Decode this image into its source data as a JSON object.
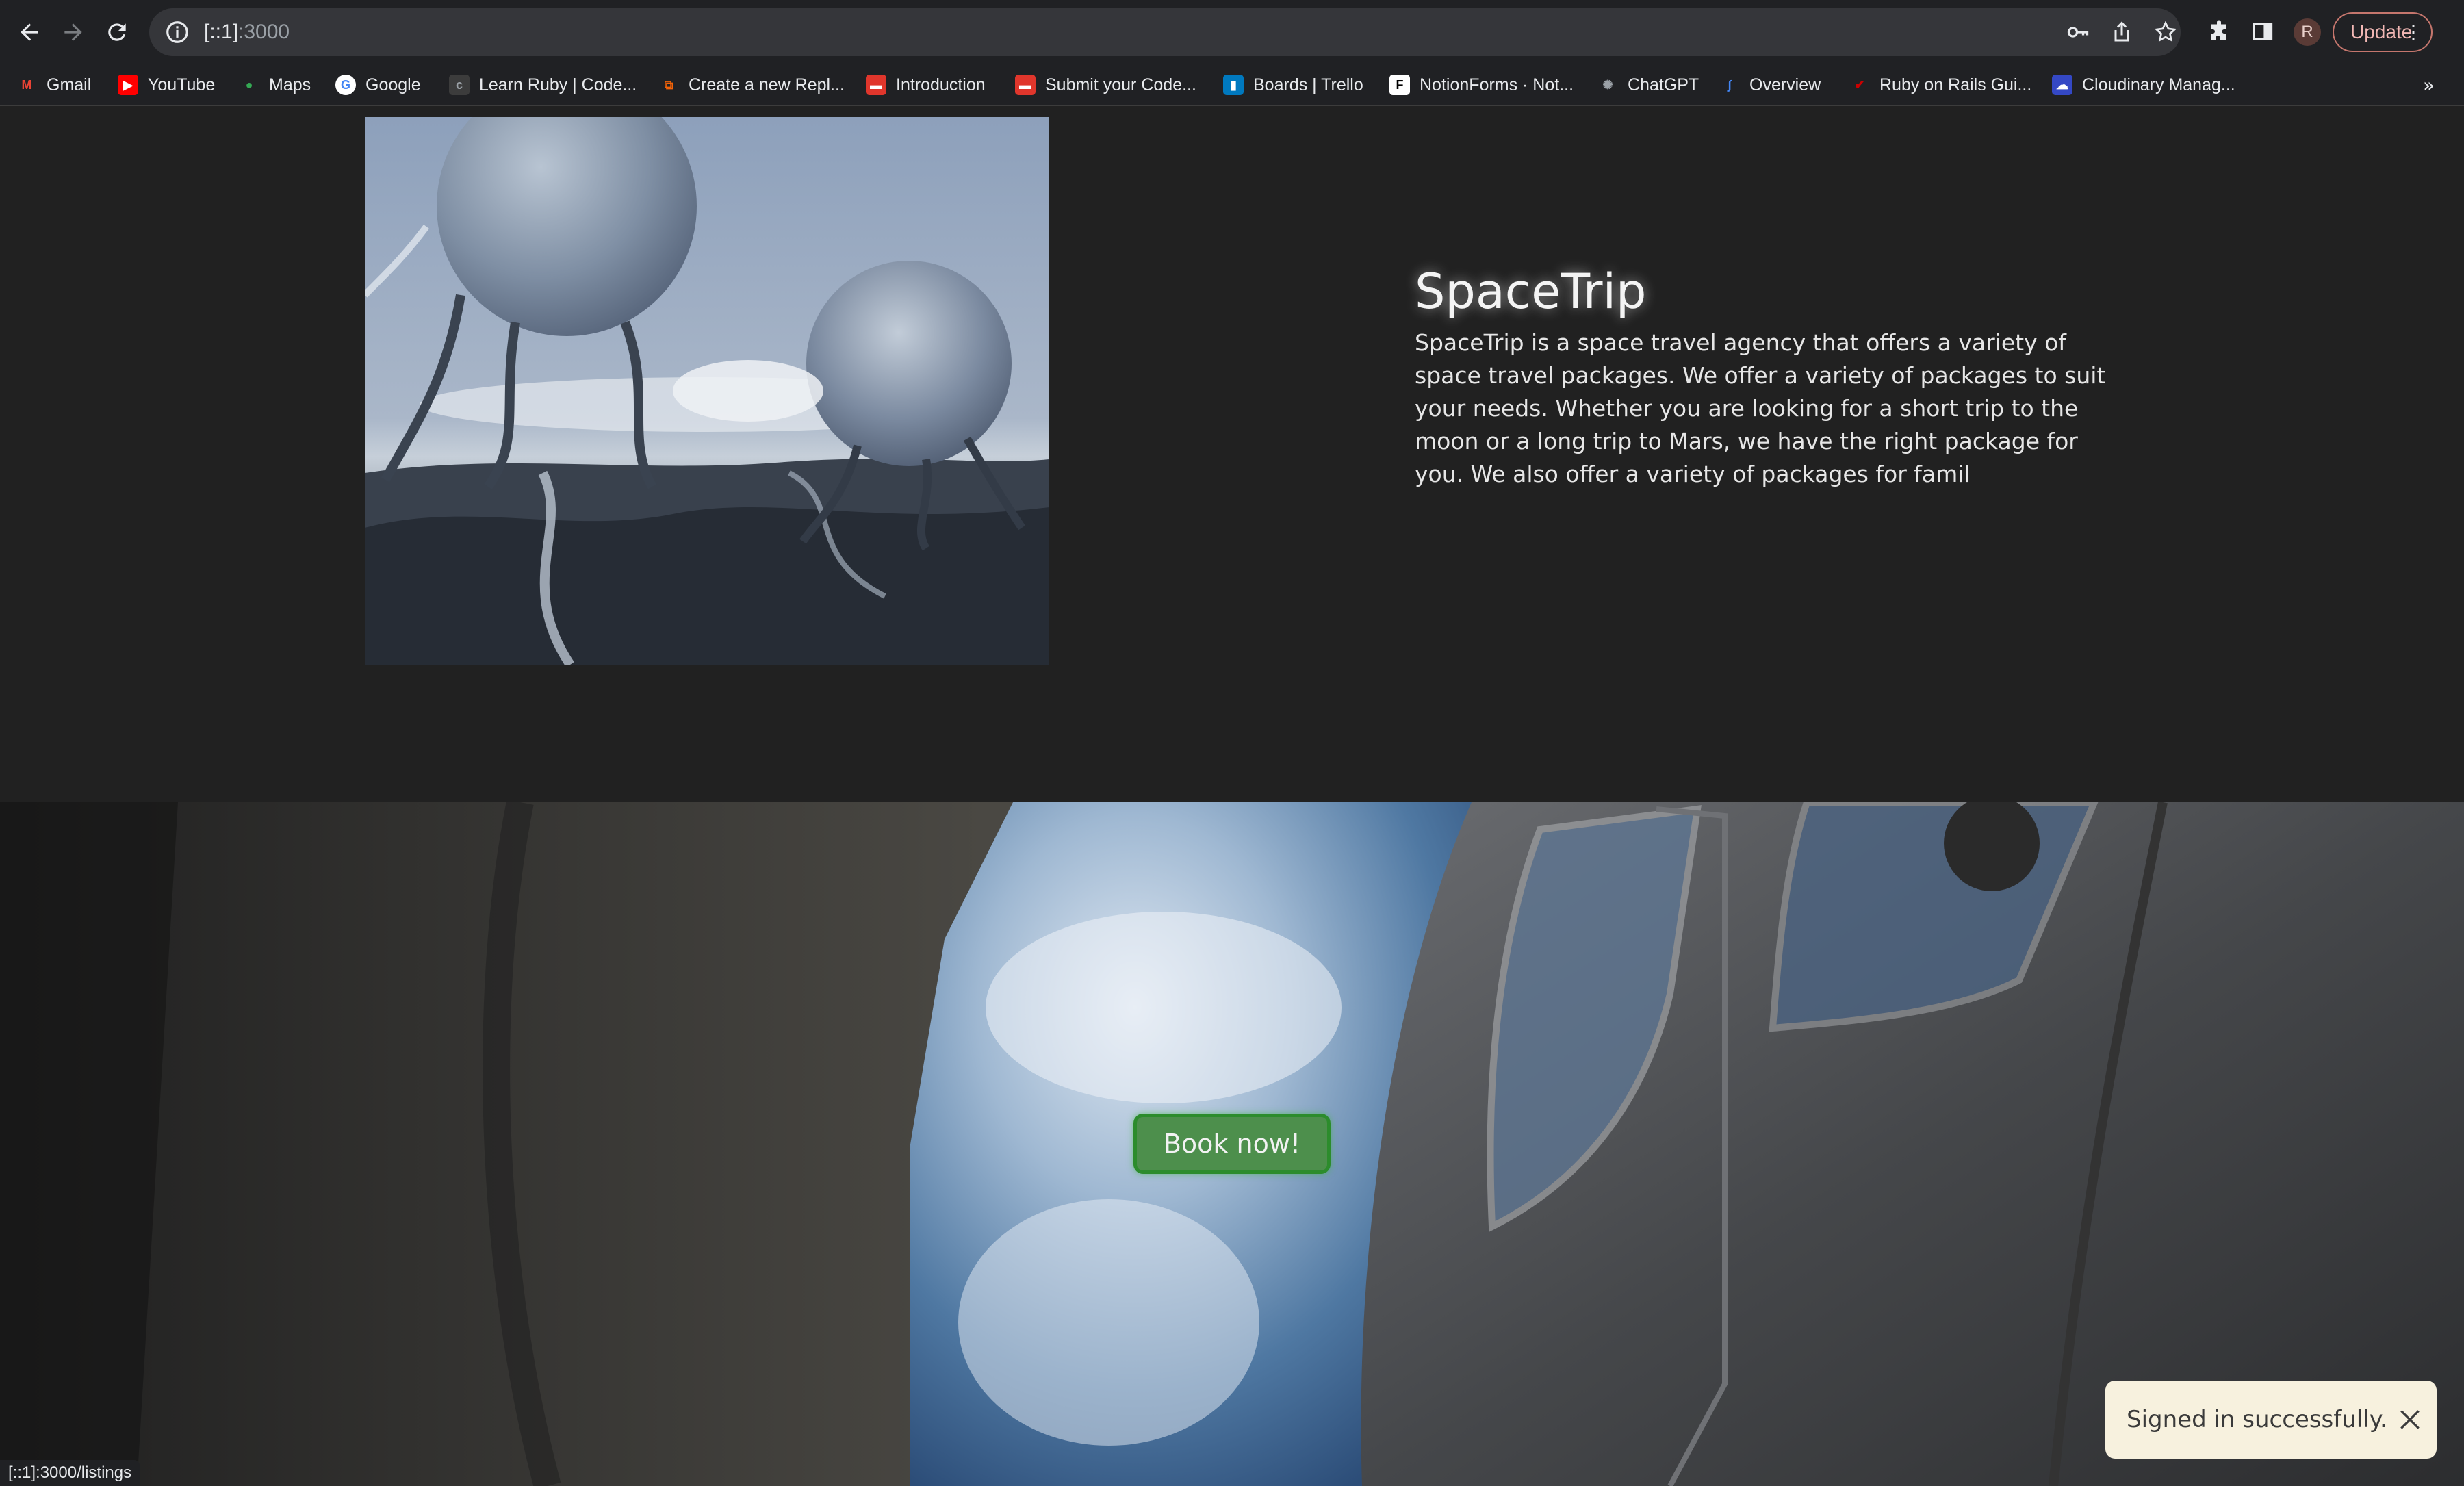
{
  "browser": {
    "url_prefix": "[::1]",
    "url_suffix": ":3000",
    "profile_initial": "R",
    "update_label": "Update",
    "status_url": "[::1]:3000/listings"
  },
  "bookmarks": [
    {
      "label": "Gmail",
      "icon": "gmail-icon",
      "color": "#ea4335"
    },
    {
      "label": "YouTube",
      "icon": "youtube-icon",
      "color": "#ff0000"
    },
    {
      "label": "Maps",
      "icon": "maps-icon",
      "color": "#34a853"
    },
    {
      "label": "Google",
      "icon": "google-icon",
      "color": "#ffffff"
    },
    {
      "label": "Learn Ruby | Code...",
      "icon": "codecademy-icon",
      "color": "#3c3c3c"
    },
    {
      "label": "Create a new Repl...",
      "icon": "replit-icon",
      "color": "#f26207"
    },
    {
      "label": "Introduction",
      "icon": "microverse-icon",
      "color": "#e0362c"
    },
    {
      "label": "Submit your Code...",
      "icon": "microverse-icon",
      "color": "#e0362c"
    },
    {
      "label": "Boards | Trello",
      "icon": "trello-icon",
      "color": "#0079bf"
    },
    {
      "label": "NotionForms · Not...",
      "icon": "notion-icon",
      "color": "#ffffff"
    },
    {
      "label": "ChatGPT",
      "icon": "openai-icon",
      "color": "#9aa0a6"
    },
    {
      "label": "Overview",
      "icon": "overview-icon",
      "color": "#4285f4"
    },
    {
      "label": "Ruby on Rails Gui...",
      "icon": "rails-icon",
      "color": "#cc0000"
    },
    {
      "label": "Cloudinary Manag...",
      "icon": "cloudinary-icon",
      "color": "#3448c5"
    }
  ],
  "hero": {
    "title": "SpaceTrip",
    "description": "SpaceTrip is a space travel agency that offers a variety of space travel packages. We offer a variety of packages to suit your needs. Whether you are looking for a short trip to the moon or a long trip to Mars, we have the right package for you. We also offer a variety of packages for famil"
  },
  "banner": {
    "book_label": "Book now!",
    "button_color": "#4d8f4c"
  },
  "toast": {
    "message": "Signed in successfully."
  }
}
